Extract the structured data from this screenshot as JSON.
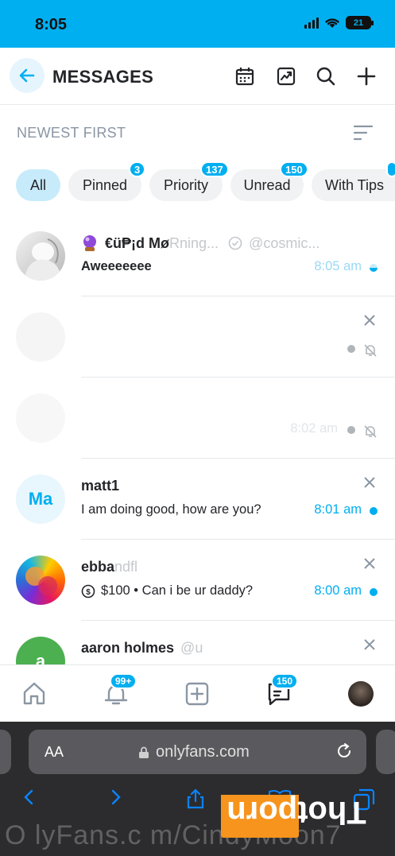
{
  "status_bar": {
    "time": "8:05",
    "battery": "21"
  },
  "header": {
    "title": "MESSAGES",
    "icons": [
      "back-arrow-icon",
      "calendar-icon",
      "chart-icon",
      "search-icon",
      "plus-icon"
    ]
  },
  "sort": {
    "label": "NEWEST FIRST"
  },
  "filters": [
    {
      "label": "All",
      "badge": ""
    },
    {
      "label": "Pinned",
      "badge": "3"
    },
    {
      "label": "Priority",
      "badge": "137"
    },
    {
      "label": "Unread",
      "badge": "150"
    },
    {
      "label": "With Tips",
      "badge": ""
    }
  ],
  "chats": [
    {
      "name": "€ü₱¡d Mø",
      "name_fade": "Rning...",
      "handle": "@cosmic...",
      "message": "Aweeeeeee",
      "time": "8:05 am"
    },
    {
      "name": "",
      "message": "",
      "time": ""
    },
    {
      "name": "",
      "message": "",
      "time": "8:02 am"
    },
    {
      "avatar_initials": "Ma",
      "name": "matt1",
      "message": "I am doing good, how are you?",
      "time": "8:01 am"
    },
    {
      "name": "ebba",
      "name_fade": "ndfl",
      "message": "$100 • Can i be ur daddy?",
      "time": "8:00 am"
    },
    {
      "avatar_initials": "a",
      "name": "aaron holmes",
      "handle": "@u",
      "message": "",
      "time": ""
    }
  ],
  "bottom_nav": {
    "notifications_badge": "99+",
    "messages_badge": "150"
  },
  "browser": {
    "aa_label": "AA",
    "url": "onlyfans.com",
    "watermark": "O lyFans.c m/CindyMoon7",
    "logo_text": "Thotporn"
  },
  "colors": {
    "accent": "#00aff0",
    "chip_active": "#c7ebfb",
    "chip_bg": "#f0f2f3",
    "text": "#242529",
    "muted": "#8a96a3",
    "logo_orange": "#f7941d"
  }
}
